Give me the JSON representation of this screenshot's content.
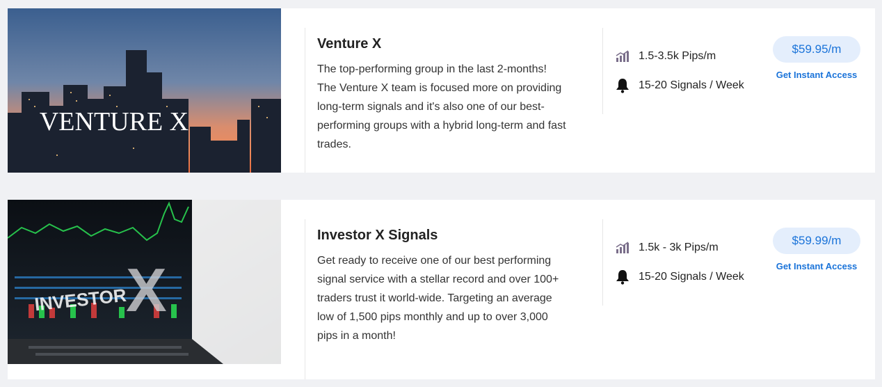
{
  "listings": [
    {
      "image_caption": "VENTURE X",
      "title": "Venture X",
      "description": "The top-performing group in the last 2-months! The Venture X team is focused more on providing long-term signals and it's also one of our best-performing groups with a hybrid long-term and fast trades.",
      "features": [
        {
          "icon": "chart-bars-icon",
          "text": "1.5-3.5k Pips/m"
        },
        {
          "icon": "bell-icon",
          "text": "15-20 Signals / Week"
        }
      ],
      "price": "$59.95/m",
      "cta": "Get Instant Access"
    },
    {
      "image_caption_left": "INVESTOR",
      "image_caption_right": "X",
      "title": "Investor X Signals",
      "description": "Get ready to receive one of our best performing signal service with a stellar record and over 100+ traders trust it world-wide. Targeting an average low of 1,500 pips monthly and up to over 3,000 pips in a month!",
      "features": [
        {
          "icon": "chart-bars-icon",
          "text": "1.5k - 3k Pips/m"
        },
        {
          "icon": "bell-icon",
          "text": "15-20 Signals / Week"
        }
      ],
      "price": "$59.99/m",
      "cta": "Get Instant Access"
    }
  ],
  "colors": {
    "accent": "#1a73d9",
    "price_bg": "#e4eefc",
    "icon": "#7a6e8a",
    "page_bg": "#f0f1f4"
  }
}
